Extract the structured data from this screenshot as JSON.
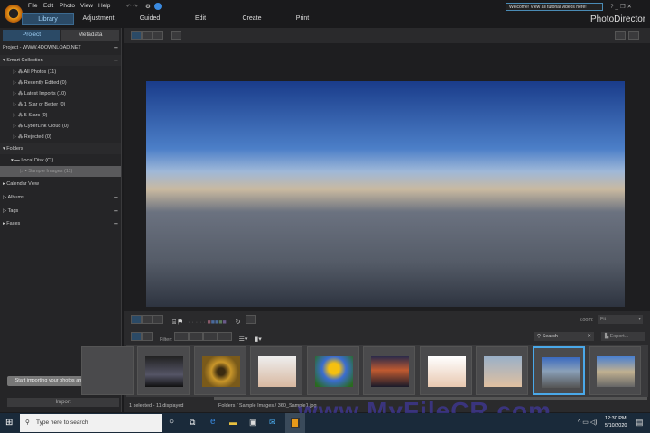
{
  "menu": [
    "File",
    "Edit",
    "Photo",
    "View",
    "Help"
  ],
  "tabs": [
    "Library",
    "Adjustment",
    "Guided",
    "Edit",
    "Create",
    "Print"
  ],
  "welcome": "Welcome! View all tutorial videos here!",
  "brand": "PhotoDirector",
  "panel": {
    "tabs": [
      "Project",
      "Metadata"
    ],
    "project": "Project - WWW.4DOWNLOAD.NET",
    "smart_collection": "Smart Collection",
    "smart_items": [
      "All Photos (11)",
      "Recently Edited (0)",
      "Latest Imports (10)",
      "1 Star or Better (0)",
      "5 Stars (0)",
      "CyberLink Cloud (0)",
      "Rejected (0)"
    ],
    "folders": "Folders",
    "local_disk": "Local Disk (C:)",
    "sample_images": "Sample Images (11)",
    "calendar": "Calendar View",
    "albums": "Albums",
    "tags": "Tags",
    "faces": "Faces",
    "tooltip": "Start importing your photos and videos here",
    "import": "Import"
  },
  "toolbar": {
    "zoom_label": "Zoom:",
    "zoom_value": "Fit",
    "filter_label": "Filter:",
    "search_placeholder": "Search",
    "export": "Export..."
  },
  "status": {
    "selection": "1 selected - 11 displayed",
    "path": "Folders / Sample Images / 360_Sample1.jpg"
  },
  "taskbar": {
    "search": "Type here to search",
    "time": "12:30 PM",
    "date": "5/10/2020"
  },
  "watermark": "www.MyFileCR.com",
  "thumbs": [
    {
      "c": "linear-gradient(#222,#556 60%,#111)"
    },
    {
      "c": "radial-gradient(circle,#3a2a10 15%,#c9962a 40%,#7a5a1a 70%)"
    },
    {
      "c": "linear-gradient(#eee,#d8b8a0)"
    },
    {
      "c": "radial-gradient(circle at 50% 40%,#f5c010 20%,#3b6dd0 45%,#2a6a20 90%)"
    },
    {
      "c": "linear-gradient(#2a2a4a,#c05a30 45%,#1a1a2a)"
    },
    {
      "c": "linear-gradient(#fff,#e8c8b0)"
    },
    {
      "c": "linear-gradient(#9ab0c8,#e0c0a0)"
    },
    {
      "c": "linear-gradient(#3a6ac0,#8aa0b8 45%,#555)"
    },
    {
      "c": "linear-gradient(#4a80d0,#c0b090 50%,#666)"
    }
  ]
}
